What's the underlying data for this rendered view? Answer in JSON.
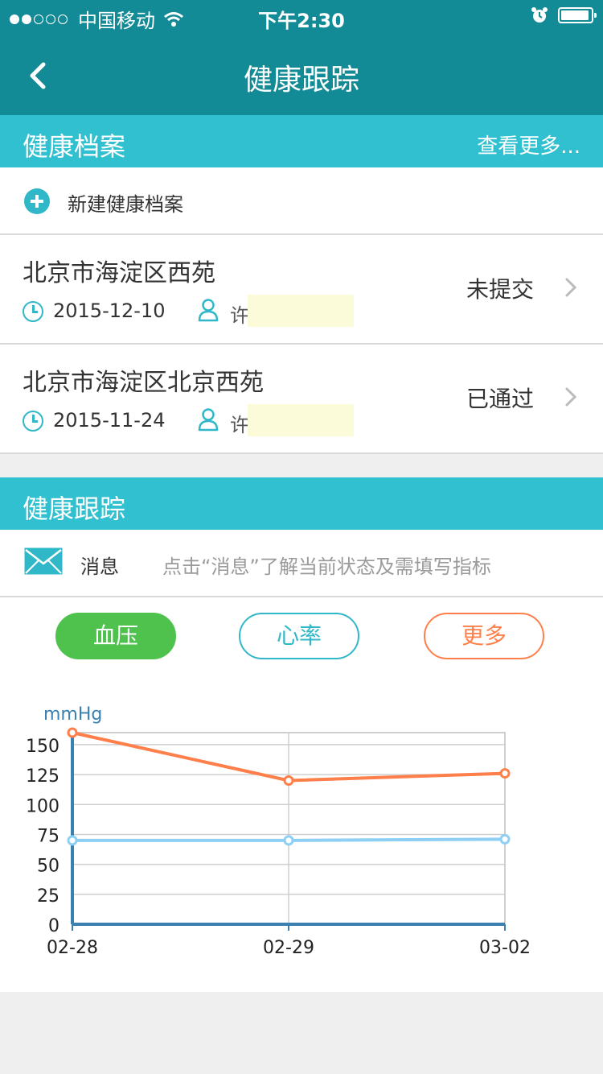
{
  "status_bar": {
    "carrier": "中国移动",
    "time": "下午2:30"
  },
  "nav": {
    "title": "健康跟踪"
  },
  "health_records": {
    "title": "健康档案",
    "more": "查看更多...",
    "new_label": "新建健康档案",
    "items": [
      {
        "address": "北京市海淀区西苑",
        "date": "2015-12-10",
        "name": "许",
        "status": "未提交"
      },
      {
        "address": "北京市海淀区北京西苑",
        "date": "2015-11-24",
        "name": "许",
        "status": "已通过"
      }
    ]
  },
  "tracking": {
    "title": "健康跟踪",
    "message_label": "消息",
    "message_hint": "点击“消息”了解当前状态及需填写指标",
    "tabs": [
      {
        "label": "血压",
        "color": "#4fc24e"
      },
      {
        "label": "心率",
        "color": "#30b8c8"
      },
      {
        "label": "更多",
        "color": "#ff7f4a"
      }
    ]
  },
  "colors": {
    "nav": "#138b96",
    "section": "#30c0d0",
    "systolic": "#ff7f4a",
    "diastolic": "#8ecff5"
  },
  "chart_data": {
    "type": "line",
    "ylabel": "mmHg",
    "categories": [
      "02-28",
      "02-29",
      "03-02"
    ],
    "y_ticks": [
      0,
      25,
      50,
      75,
      100,
      125,
      150
    ],
    "ylim": [
      0,
      160
    ],
    "grid": true,
    "series": [
      {
        "values": [
          160,
          120,
          126
        ],
        "color": "#ff7f4a"
      },
      {
        "values": [
          70,
          70,
          71
        ],
        "color": "#8ecff5"
      }
    ]
  }
}
